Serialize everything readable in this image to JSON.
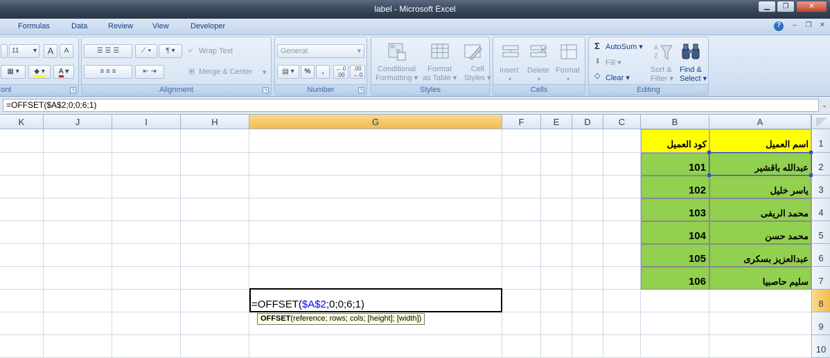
{
  "window": {
    "title": "label - Microsoft Excel",
    "minimize_glyph": "▁",
    "restore_glyph": "❐",
    "close_glyph": "✕"
  },
  "tabs": [
    "Formulas",
    "Data",
    "Review",
    "View",
    "Developer"
  ],
  "mdi": {
    "help_glyph": "?",
    "minimize_glyph": "–",
    "restore_glyph": "❐",
    "close_glyph": "✕"
  },
  "ribbon": {
    "font": {
      "group_label": "ont",
      "size_value": "11",
      "grow_label": "A",
      "shrink_label": "A",
      "font_color_label": "A"
    },
    "alignment": {
      "group_label": "Alignment",
      "wrap_text": "Wrap Text",
      "merge_center": "Merge & Center"
    },
    "number": {
      "group_label": "Number",
      "format_value": "General",
      "percent": "%",
      "comma": ",",
      "increase_decimal": "←.0\n.00",
      "decrease_decimal": ".00\n→.0"
    },
    "styles": {
      "group_label": "Styles",
      "conditional_formatting": [
        "Conditional",
        "Formatting"
      ],
      "format_as_table": [
        "Format",
        "as Table"
      ],
      "cell_styles": [
        "Cell",
        "Styles"
      ]
    },
    "cells": {
      "group_label": "Cells",
      "insert": "Insert",
      "delete": "Delete",
      "format": "Format"
    },
    "editing": {
      "group_label": "Editing",
      "autosum": "AutoSum",
      "fill": "Fill",
      "clear": "Clear",
      "sort_filter": [
        "Sort &",
        "Filter"
      ],
      "find_select": [
        "Find &",
        "Select"
      ],
      "sigma_glyph": "Σ"
    }
  },
  "formula_bar": {
    "value": "=OFFSET($A$2;0;0;6;1)",
    "expand_glyph": "¥"
  },
  "columns": [
    "K",
    "J",
    "I",
    "H",
    "G",
    "F",
    "E",
    "D",
    "C",
    "B",
    "A"
  ],
  "selected_column": "G",
  "rows": [
    "1",
    "2",
    "3",
    "4",
    "5",
    "6",
    "7",
    "8",
    "9",
    "10"
  ],
  "selected_row": "8",
  "table": {
    "headers": {
      "name": "اسم العميل",
      "code": "كود العميل"
    },
    "records": [
      {
        "name": "عبدالله باقشير",
        "code": "101"
      },
      {
        "name": "ياسر خليل",
        "code": "102"
      },
      {
        "name": "محمد الريفى",
        "code": "103"
      },
      {
        "name": "محمد حسن",
        "code": "104"
      },
      {
        "name": "عبدالعزيز بسكرى",
        "code": "105"
      },
      {
        "name": "سليم حاصبيا",
        "code": "106"
      }
    ]
  },
  "edit_cell": {
    "prefix": "=OFFSET(",
    "reference": "$A$2",
    "suffix": ";0;0;6;1)"
  },
  "tooltip": {
    "function_name": "OFFSET",
    "args": "(reference; rows; cols; [height]; [width])"
  },
  "colors": {
    "header_fill": "#ffff00",
    "data_fill": "#92d050",
    "selected_header": "#f3bb4f"
  }
}
